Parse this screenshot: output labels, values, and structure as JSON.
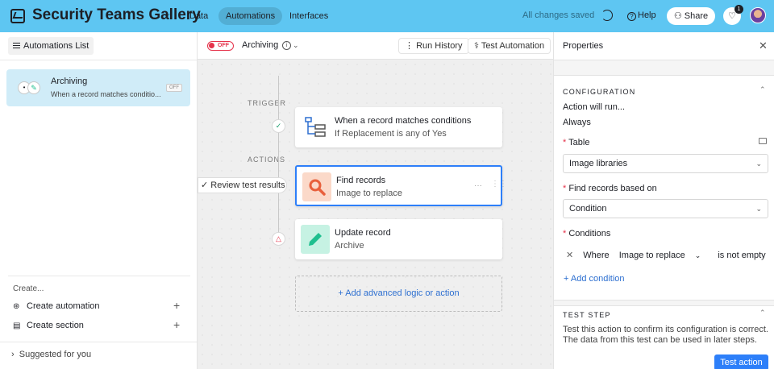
{
  "topbar": {
    "app_title": "Security Teams Gallery",
    "nav": [
      {
        "label": "Data",
        "active": false
      },
      {
        "label": "Automations",
        "active": true
      },
      {
        "label": "Interfaces",
        "active": false
      }
    ],
    "saved_status": "All changes saved",
    "help_label": "Help",
    "share_label": "Share",
    "notification_count": "1",
    "accent_color": "#5ec6f2"
  },
  "sidebar": {
    "list_button_label": "Automations List",
    "automation": {
      "name": "Archiving",
      "description": "When a record matches conditio...",
      "status": "OFF"
    },
    "create_header": "Create...",
    "create_automation_label": "Create automation",
    "create_section_label": "Create section",
    "suggested_label": "Suggested for you"
  },
  "canvas": {
    "toggle_label": "OFF",
    "automation_title": "Archiving",
    "run_history_label": "Run History",
    "test_automation_label": "Test Automation",
    "trigger_label": "TRIGGER",
    "actions_label": "ACTIONS",
    "trigger_card": {
      "title": "When a record matches conditions",
      "subtitle": "If Replacement is any of Yes"
    },
    "find_card": {
      "title": "Find records",
      "subtitle": "Image to replace"
    },
    "update_card": {
      "title": "Update record",
      "subtitle": "Archive"
    },
    "review_label": "Review test results",
    "add_action_label": "Add advanced logic or action"
  },
  "panel": {
    "title": "Properties",
    "configuration_header": "CONFIGURATION",
    "action_will_run_label": "Action will run...",
    "action_will_run_value": "Always",
    "table_label": "Table",
    "table_value": "Image libraries",
    "find_based_on_label": "Find records based on",
    "find_based_on_value": "Condition",
    "conditions_label": "Conditions",
    "condition": {
      "where": "Where",
      "field": "Image to replace",
      "operator": "is not empty"
    },
    "add_condition_label": "Add condition",
    "test_step_header": "TEST STEP",
    "test_step_description": "Test this action to confirm its configuration is correct. The data from this test can be used in later steps.",
    "test_button_label": "Test action"
  }
}
